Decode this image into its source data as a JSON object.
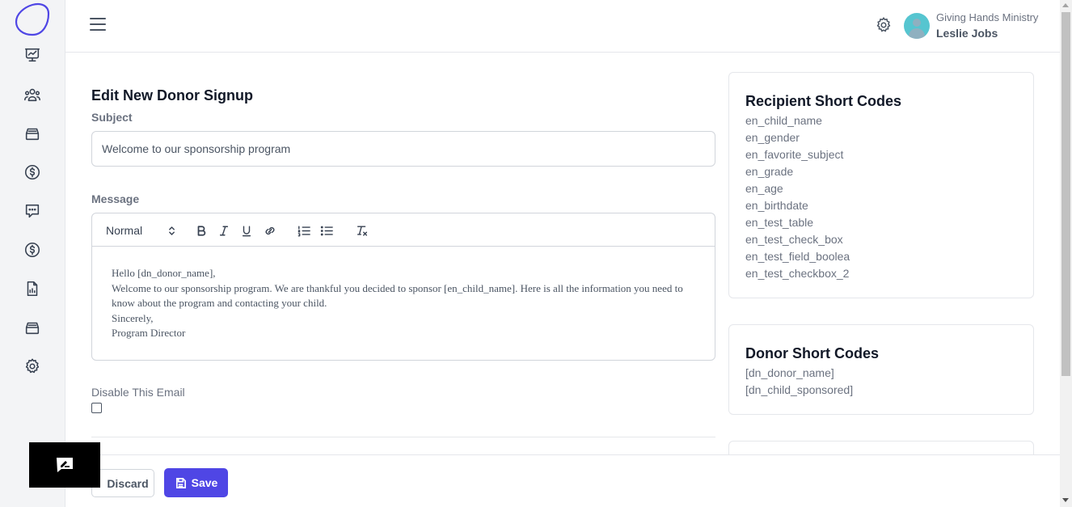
{
  "header": {
    "org_name": "Giving Hands Ministry",
    "user_name": "Leslie Jobs"
  },
  "sidebar": {
    "items": [
      {
        "icon": "presentation-chart-icon"
      },
      {
        "icon": "user-group-icon"
      },
      {
        "icon": "inbox-stack-icon"
      },
      {
        "icon": "currency-dollar-icon"
      },
      {
        "icon": "chat-bubble-icon"
      },
      {
        "icon": "currency-dollar-icon"
      },
      {
        "icon": "document-chart-icon"
      },
      {
        "icon": "inbox-stack-icon"
      },
      {
        "icon": "gear-icon"
      }
    ]
  },
  "form": {
    "title": "Edit New Donor Signup",
    "subject_label": "Subject",
    "subject_value": "Welcome to our sponsorship program",
    "message_label": "Message",
    "format_value": "Normal",
    "message_lines": [
      "Hello [dn_donor_name],",
      "Welcome to our sponsorship program. We are thankful you decided to sponsor [en_child_name]. Here is all the information you need to know about the program and contacting your child.",
      "Sincerely,",
      "Program Director"
    ],
    "disable_label": "Disable This Email",
    "disable_checked": false
  },
  "recipient_codes": {
    "title": "Recipient Short Codes",
    "items": [
      "en_child_name",
      "en_gender",
      "en_favorite_subject",
      "en_grade",
      "en_age",
      "en_birthdate",
      "en_test_table",
      "en_test_check_box",
      "en_test_field_boolea",
      "en_test_checkbox_2"
    ]
  },
  "donor_codes": {
    "title": "Donor Short Codes",
    "items": [
      "[dn_donor_name]",
      "[dn_child_sponsored]"
    ]
  },
  "footer": {
    "discard_label": "Discard",
    "save_label": "Save"
  },
  "colors": {
    "accent": "#4f46e5",
    "logo": "#4f46e5"
  }
}
